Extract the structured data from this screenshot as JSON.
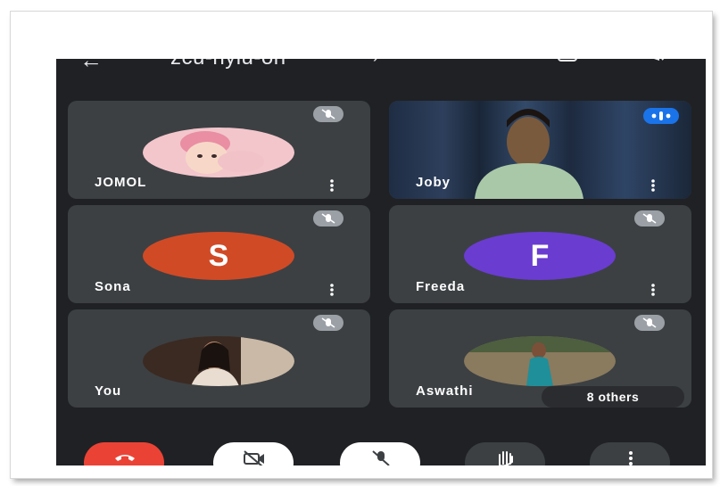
{
  "meeting": {
    "code": "zcu-nyiu-oh",
    "back_icon": "arrow-left-icon",
    "switch_camera_icon": "switch-camera-icon",
    "speaker_icon": "speaker-icon"
  },
  "participants": [
    {
      "name": "JOMOL",
      "type": "photo",
      "muted": true
    },
    {
      "name": "Joby",
      "type": "video",
      "muted": false,
      "speaking": true
    },
    {
      "name": "Sona",
      "type": "letter",
      "letter": "S",
      "color": "#d04a26",
      "muted": true
    },
    {
      "name": "Freeda",
      "type": "letter",
      "letter": "F",
      "color": "#6a3cd0",
      "muted": true
    },
    {
      "name": "You",
      "type": "photo",
      "muted": true
    },
    {
      "name": "Aswathi",
      "type": "photo",
      "muted": true,
      "others_label": "8 others"
    }
  ],
  "controls": {
    "end_call": "end-call-icon",
    "camera": "camera-off-icon",
    "mic": "mic-off-icon",
    "hand": "raise-hand-icon",
    "more": "more-vertical-icon"
  },
  "colors": {
    "background": "#202124",
    "tile": "#3c4043",
    "end_call": "#ea4335",
    "speaking": "#1a73e8"
  }
}
